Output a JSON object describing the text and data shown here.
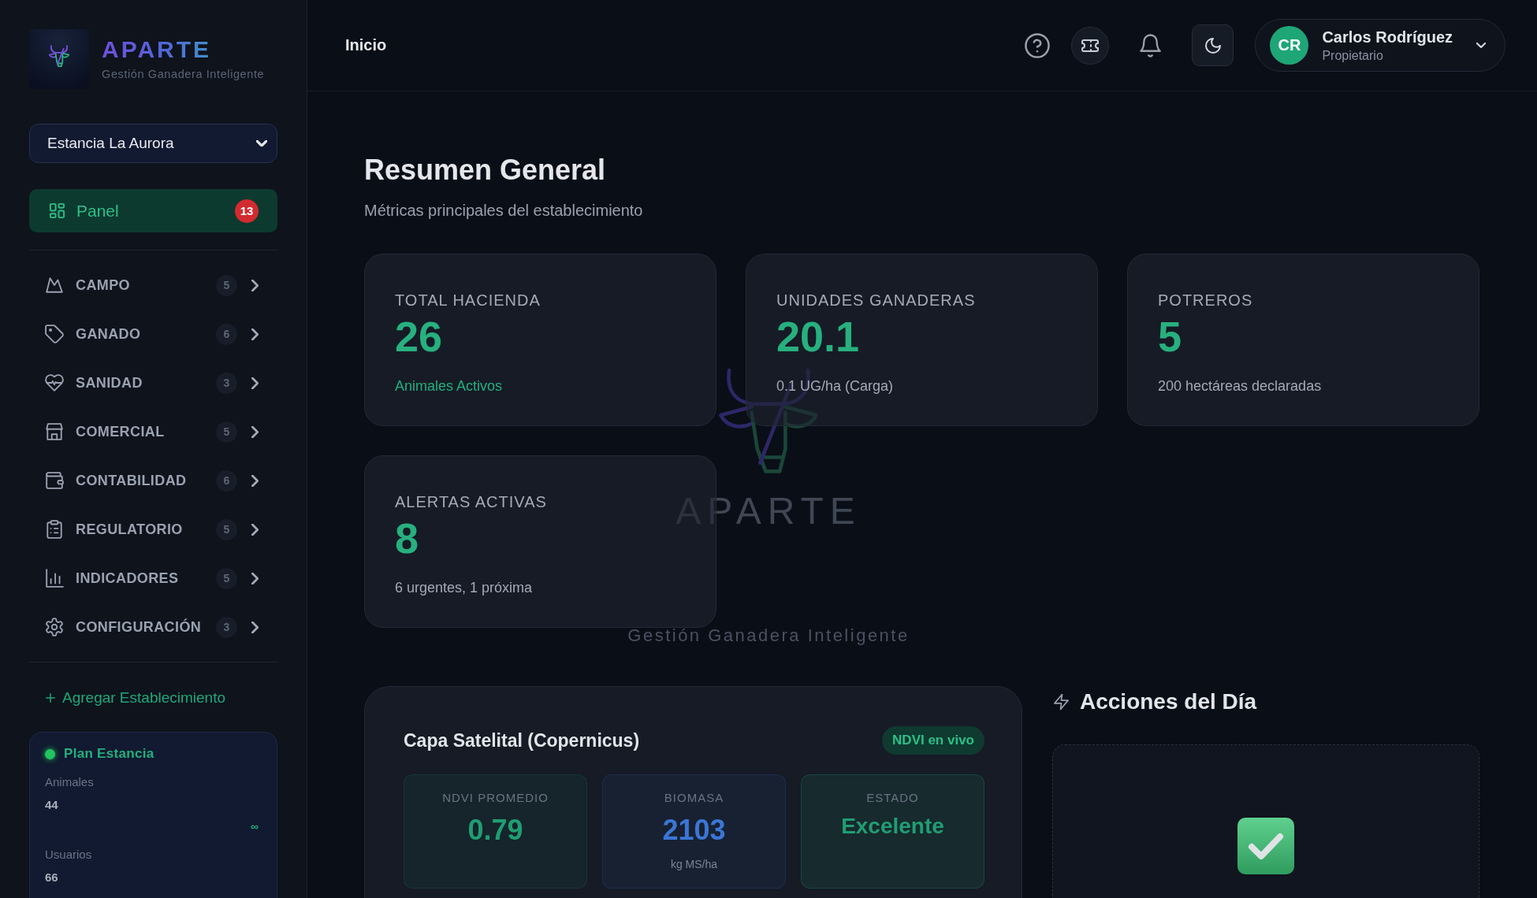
{
  "sidebar": {
    "brand": {
      "name": "APARTE",
      "tagline": "Gestión Ganadera Inteligente"
    },
    "establishment_select": {
      "value": "Estancia La Aurora"
    },
    "nav_items": [
      {
        "kind": "link",
        "label": "Panel",
        "badge": "13",
        "selected": true
      },
      {
        "kind": "group",
        "label": "CAMPO",
        "count": "5",
        "selected": false,
        "expanded": false
      },
      {
        "kind": "group",
        "label": "GANADO",
        "count": "6",
        "selected": false,
        "expanded": false
      },
      {
        "kind": "group",
        "label": "SANIDAD",
        "count": "3",
        "selected": false,
        "expanded": false
      },
      {
        "kind": "group",
        "label": "COMERCIAL",
        "count": "5",
        "selected": false,
        "expanded": false
      },
      {
        "kind": "group",
        "label": "CONTABILIDAD",
        "count": "6",
        "selected": false,
        "expanded": false
      },
      {
        "kind": "group",
        "label": "REGULATORIO",
        "count": "5",
        "selected": false,
        "expanded": false
      },
      {
        "kind": "group",
        "label": "INDICADORES",
        "count": "5",
        "selected": false,
        "expanded": false
      },
      {
        "kind": "group",
        "label": "CONFIGURACIÓN",
        "count": "3",
        "selected": false,
        "expanded": false
      }
    ],
    "add_establishment": {
      "label": "Agregar Establecimiento"
    },
    "plan": {
      "title": "Plan Estancia",
      "active": true,
      "usage": [
        {
          "label": "Animales",
          "value": "44",
          "limit": "∞"
        },
        {
          "label": "Usuarios",
          "value": "66"
        }
      ]
    }
  },
  "header": {
    "title": "Inicio",
    "user": {
      "initials": "CR",
      "name": "Carlos Rodríguez",
      "role": "Propietario"
    }
  },
  "page_header": {
    "title": "Resumen General",
    "subtitle": "Métricas principales del establecimiento"
  },
  "stat_cards": [
    {
      "label": "TOTAL HACIENDA",
      "value": "26",
      "note": "Animales Activos",
      "note_accent": true
    },
    {
      "label": "UNIDADES GANADERAS",
      "value": "20.1",
      "note": "0.1 UG/ha (Carga)",
      "note_accent": false
    },
    {
      "label": "POTREROS",
      "value": "5",
      "note": "200 hectáreas declaradas",
      "note_accent": false
    },
    {
      "label": "ALERTAS ACTIVAS",
      "value": "8",
      "note": "6 urgentes, 1 próxima",
      "note_accent": false
    }
  ],
  "watermark": {
    "title": "APARTE",
    "tagline": "Gestión Ganadera Inteligente"
  },
  "satellite_panel": {
    "title": "Capa Satelital (Copernicus)",
    "badge": "NDVI en vivo",
    "metrics": [
      {
        "kind": "number",
        "label": "NDVI PROMEDIO",
        "value": "0.79",
        "color": "#1f9e72"
      },
      {
        "kind": "number",
        "label": "BIOMASA",
        "value": "2103",
        "unit": "kg MS/ha",
        "color": "#3a76d6"
      },
      {
        "kind": "status",
        "label": "ESTADO",
        "value": "Excelente",
        "color": "#1f9e72"
      }
    ]
  },
  "daily_actions": {
    "title": "Acciones del Día"
  }
}
